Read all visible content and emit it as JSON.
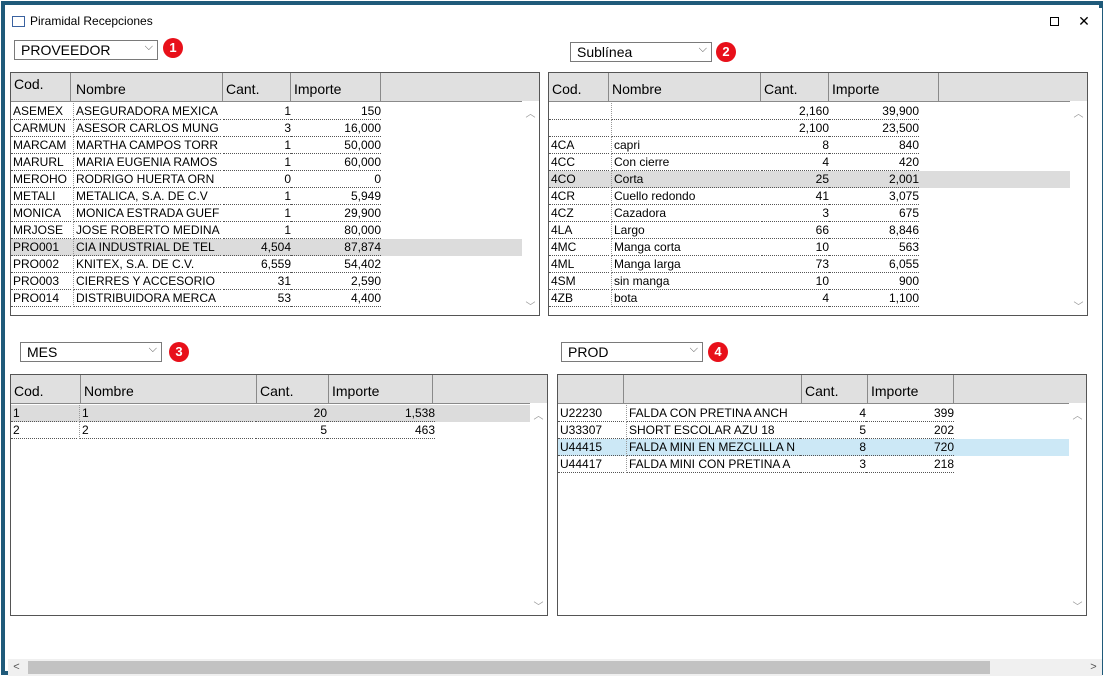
{
  "window": {
    "title": "Piramidal Recepciones"
  },
  "panels": [
    {
      "selector": "PROVEEDOR",
      "badge": "1",
      "headers": [
        "Cod.",
        "Nombre",
        "Cant.",
        "Importe"
      ],
      "rows": [
        [
          "ASEMEX",
          "ASEGURADORA MEXICA",
          "1",
          "150"
        ],
        [
          "CARMUN",
          "ASESOR CARLOS MUNG",
          "3",
          "16,000"
        ],
        [
          "MARCAM",
          "MARTHA CAMPOS TORR",
          "1",
          "50,000"
        ],
        [
          "MARURL",
          "MARIA EUGENIA RAMOS",
          "1",
          "60,000"
        ],
        [
          "MEROHO",
          "RODRIGO HUERTA ORN",
          "0",
          "0"
        ],
        [
          "METALI",
          "METALICA, S.A. DE C.V",
          "1",
          "5,949"
        ],
        [
          "MONICA",
          "MONICA ESTRADA GUEF",
          "1",
          "29,900"
        ],
        [
          "MRJOSE",
          "JOSE ROBERTO MEDINA",
          "1",
          "80,000"
        ],
        [
          "PRO001",
          "CIA INDUSTRIAL DE TEL",
          "4,504",
          "87,874"
        ],
        [
          "PRO002",
          "KNITEX, S.A. DE C.V.",
          "6,559",
          "54,402"
        ],
        [
          "PRO003",
          "CIERRES Y ACCESORIO",
          "31",
          "2,590"
        ],
        [
          "PRO014",
          "DISTRIBUIDORA MERCA",
          "53",
          "4,400"
        ]
      ],
      "selected_row": 8
    },
    {
      "selector": "Sublínea",
      "badge": "2",
      "headers": [
        "Cod.",
        "Nombre",
        "Cant.",
        "Importe"
      ],
      "rows": [
        [
          "",
          "",
          "2,160",
          "39,900"
        ],
        [
          "",
          "",
          "2,100",
          "23,500"
        ],
        [
          "4CA",
          "capri",
          "8",
          "840"
        ],
        [
          "4CC",
          "Con cierre",
          "4",
          "420"
        ],
        [
          "4CO",
          "Corta",
          "25",
          "2,001"
        ],
        [
          "4CR",
          "Cuello redondo",
          "41",
          "3,075"
        ],
        [
          "4CZ",
          "Cazadora",
          "3",
          "675"
        ],
        [
          "4LA",
          "Largo",
          "66",
          "8,846"
        ],
        [
          "4MC",
          "Manga corta",
          "10",
          "563"
        ],
        [
          "4ML",
          "Manga larga",
          "73",
          "6,055"
        ],
        [
          "4SM",
          "sin manga",
          "10",
          "900"
        ],
        [
          "4ZB",
          "bota",
          "4",
          "1,100"
        ]
      ],
      "selected_row": 4
    },
    {
      "selector": "MES",
      "badge": "3",
      "headers": [
        "Cod.",
        "Nombre",
        "Cant.",
        "Importe"
      ],
      "rows": [
        [
          "1",
          "1",
          "20",
          "1,538"
        ],
        [
          "2",
          "2",
          "5",
          "463"
        ]
      ],
      "selected_row": 0
    },
    {
      "selector": "PROD",
      "badge": "4",
      "headers": [
        "",
        "",
        "Cant.",
        "Importe"
      ],
      "rows": [
        [
          "U22230",
          "FALDA CON PRETINA ANCH",
          "4",
          "399"
        ],
        [
          "U33307",
          "SHORT ESCOLAR AZU 18",
          "5",
          "202"
        ],
        [
          "U44415",
          "FALDA MINI EN MEZCLILLA N",
          "8",
          "720"
        ],
        [
          "U44417",
          "FALDA MINI CON PRETINA A",
          "3",
          "218"
        ]
      ],
      "selected_row": 2
    }
  ],
  "colors": {
    "badge": "#e8101a",
    "frame": "#1f5a7a",
    "selected": "#dcdcdc",
    "highlight": "#cce8f6"
  }
}
